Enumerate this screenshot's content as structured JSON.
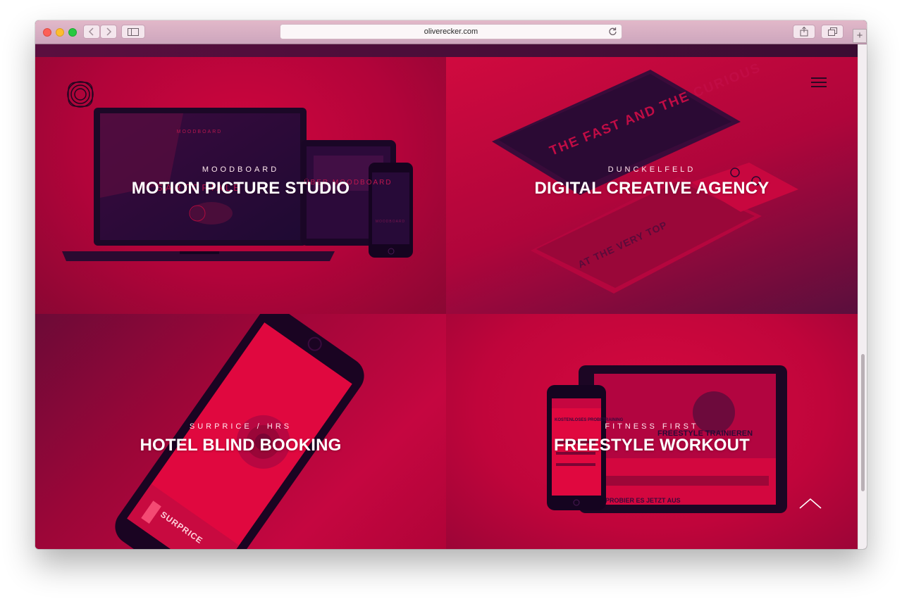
{
  "browser": {
    "url": "oliverecker.com",
    "new_tab_label": "+"
  },
  "projects": [
    {
      "subtitle": "MOODBOARD",
      "title": "MOTION PICTURE STUDIO"
    },
    {
      "subtitle": "DUNCKELFELD",
      "title": "DIGITAL CREATIVE AGENCY"
    },
    {
      "subtitle": "SURPRICE / HRS",
      "title": "HOTEL BLIND BOOKING"
    },
    {
      "subtitle": "FITNESS FIRST",
      "title": "FREESTYLE WORKOUT"
    }
  ],
  "mockup_text": {
    "moodboard_brand": "MOODBOARD",
    "moodboard_headline": "SARTORIALE",
    "moodboard_tablet": "ÜBER MOODBOARD",
    "dunckelfeld_headline": "THE FAST AND THE CURIOUS",
    "dunckelfeld_tagline": "AT THE VERY TOP",
    "surprice_brand": "SURPRICE",
    "fitness_phone_headline": "KOSTENLOSES PROBETRAINING",
    "fitness_tablet_headline": "FREESTYLE TRAINIEREN",
    "fitness_tablet_footer": "PROBIER ES JETZT AUS"
  },
  "colors": {
    "accent_red": "#c8073f",
    "deep_purple": "#2a0a35",
    "white": "#ffffff"
  },
  "icons": [
    "close-icon",
    "minimize-icon",
    "zoom-icon",
    "back-icon",
    "forward-icon",
    "sidebar-icon",
    "reload-icon",
    "share-icon",
    "tabs-icon",
    "logo-icon",
    "hamburger-icon",
    "chevron-up-icon"
  ]
}
